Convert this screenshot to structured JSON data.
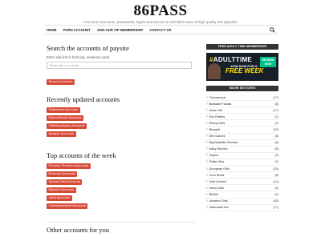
{
  "site": {
    "title": "86PASS",
    "tagline": "Free porn accounts, passwords, logins and access to members area of high quality sex paysites"
  },
  "nav": {
    "items": [
      "HOME",
      "PORN ACCOUNT",
      "JOIN OUR VIP MEMBERSHIP",
      "CONTACT US"
    ],
    "search_icon": "search-icon"
  },
  "search_section": {
    "title": "Search the accounts of paysite",
    "hint": "Enter site link or host (eg. someone.com)",
    "placeholder": "Enter site url or host",
    "button": "Search Accounts"
  },
  "recent": {
    "title": "Recently updated accounts",
    "items": [
      "Teamskeet Accounts",
      "Ravenoffreak Accounts",
      "Lifeinboatdyass Accounts",
      "Analyze Accounts"
    ]
  },
  "top": {
    "title": "Top accounts of the week",
    "items": [
      "Pornhub Premium Accounts",
      "Brazzers Accounts",
      "Sodoes Red Accounts",
      "Blacked Accounts",
      "Jwird Accounts",
      "Czechstreetsnet Accounts"
    ]
  },
  "other": {
    "title": "Other accounts for you"
  },
  "sidebar": {
    "banner_heading": "FREE ADULT TIME MEMBERSHIP",
    "banner": {
      "logo_prefix": "#",
      "logo_text": "ADULTTIME",
      "subtitle": "JOIN NOW FOR A",
      "highlight": "FREE WEEK",
      "cta": "REDEEM NOW"
    },
    "niche_heading": "NICHE SEX SITES",
    "niches": [
      {
        "label": "Transsexual",
        "count": "(17)"
      },
      {
        "label": "Bukkake Facials",
        "count": "(8)"
      },
      {
        "label": "Asian Girl",
        "count": "(27)"
      },
      {
        "label": "Sex Parties",
        "count": "(7)"
      },
      {
        "label": "Ebony Girls",
        "count": "(9)"
      },
      {
        "label": "Blowjob",
        "count": "(29)"
      },
      {
        "label": "Sex Games",
        "count": "(8)"
      },
      {
        "label": "Big Beautiful Woman",
        "count": "(8)"
      },
      {
        "label": "Hairy Women",
        "count": "(8)"
      },
      {
        "label": "Voyeur",
        "count": "(9)"
      },
      {
        "label": "Petite Girls",
        "count": "(3)"
      },
      {
        "label": "European Girls",
        "count": "(25)"
      },
      {
        "label": "Cum Shots",
        "count": "(8)"
      },
      {
        "label": "Soft Content",
        "count": "(14)"
      },
      {
        "label": "Hand Jobs",
        "count": "(5)"
      },
      {
        "label": "BDSM",
        "count": "(2)"
      },
      {
        "label": "Amateur Girls",
        "count": "(45)"
      },
      {
        "label": "Interracial Sex",
        "count": "(17)"
      }
    ]
  }
}
